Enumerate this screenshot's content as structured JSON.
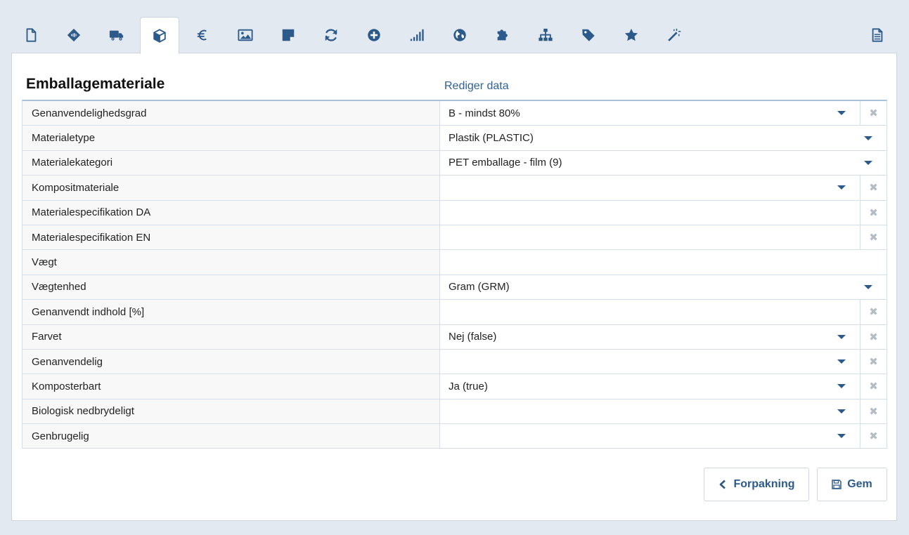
{
  "tabs": [
    {
      "icon": "document-icon"
    },
    {
      "icon": "barcode-tag-icon"
    },
    {
      "icon": "truck-icon"
    },
    {
      "icon": "box-icon",
      "active": true
    },
    {
      "icon": "euro-icon"
    },
    {
      "icon": "image-icon"
    },
    {
      "icon": "note-icon"
    },
    {
      "icon": "refresh-icon"
    },
    {
      "icon": "plus-circle-icon"
    },
    {
      "icon": "signal-icon"
    },
    {
      "icon": "globe-icon"
    },
    {
      "icon": "puzzle-icon"
    },
    {
      "icon": "sitemap-icon"
    },
    {
      "icon": "tag-icon"
    },
    {
      "icon": "star-icon"
    },
    {
      "icon": "magic-wand-icon"
    },
    {
      "icon": "file-text-icon"
    }
  ],
  "section": {
    "title": "Emballagemateriale",
    "edit_link": "Rediger data"
  },
  "rows": [
    {
      "label": "Genanvendelighedsgrad",
      "value": "B - mindst 80%",
      "type": "select",
      "clearable": true
    },
    {
      "label": "Materialetype",
      "value": "Plastik (PLASTIC)",
      "type": "select",
      "clearable": false
    },
    {
      "label": "Materialekategori",
      "value": "PET emballage - film (9)",
      "type": "select",
      "clearable": false
    },
    {
      "label": "Kompositmateriale",
      "value": "",
      "type": "select",
      "clearable": true
    },
    {
      "label": "Materialespecifikation DA",
      "value": "",
      "type": "text",
      "clearable": true
    },
    {
      "label": "Materialespecifikation EN",
      "value": "",
      "type": "text",
      "clearable": true
    },
    {
      "label": "Vægt",
      "value": "",
      "type": "text",
      "clearable": false
    },
    {
      "label": "Vægtenhed",
      "value": "Gram (GRM)",
      "type": "select",
      "clearable": false
    },
    {
      "label": "Genanvendt indhold [%]",
      "value": "",
      "type": "text",
      "clearable": true
    },
    {
      "label": "Farvet",
      "value": "Nej (false)",
      "type": "select",
      "clearable": true
    },
    {
      "label": "Genanvendelig",
      "value": "",
      "type": "select",
      "clearable": true
    },
    {
      "label": "Komposterbart",
      "value": "Ja (true)",
      "type": "select",
      "clearable": true
    },
    {
      "label": "Biologisk nedbrydeligt",
      "value": "",
      "type": "select",
      "clearable": true
    },
    {
      "label": "Genbrugelig",
      "value": "",
      "type": "select",
      "clearable": true
    }
  ],
  "buttons": {
    "back_label": "Forpakning",
    "back_icon": "chevron-left-icon",
    "save_label": "Gem",
    "save_icon": "floppy-disk-icon"
  },
  "clear_glyph": "✖",
  "colors": {
    "accent": "#2c5a8a",
    "page_bg": "#e3e9f0",
    "link": "#2e6296"
  }
}
